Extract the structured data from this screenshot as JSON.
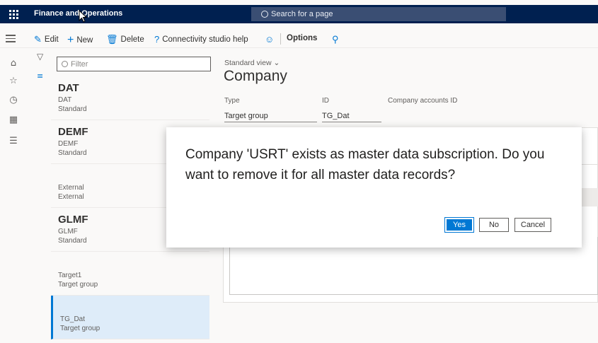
{
  "header": {
    "app_title": "Finance and Operations",
    "search_placeholder": "Search for a page"
  },
  "actions": {
    "edit": "Edit",
    "new": "New",
    "delete": "Delete",
    "connectivity_help": "Connectivity studio help",
    "options": "Options"
  },
  "list": {
    "filter_placeholder": "Filter",
    "items": [
      {
        "title": "DAT",
        "line1": "DAT",
        "line2": "Standard"
      },
      {
        "title": "DEMF",
        "line1": "DEMF",
        "line2": "Standard"
      },
      {
        "title": "",
        "line1": "External",
        "line2": "External"
      },
      {
        "title": "GLMF",
        "line1": "GLMF",
        "line2": "Standard"
      },
      {
        "title": "",
        "line1": "Target1",
        "line2": "Target group"
      },
      {
        "title": "",
        "line1": "TG_Dat",
        "line2": "Target group"
      }
    ]
  },
  "details": {
    "view_label": "Standard view",
    "page_title": "Company",
    "fields": [
      {
        "label": "Type",
        "value": "Target group"
      },
      {
        "label": "ID",
        "value": "TG_Dat"
      },
      {
        "label": "Company accounts ID",
        "value": ""
      }
    ]
  },
  "dialog": {
    "message": "Company 'USRT' exists as master data subscription. Do you want to remove it for all master data records?",
    "yes": "Yes",
    "no": "No",
    "cancel": "Cancel"
  },
  "colors": {
    "navbar": "#002050",
    "accent": "#0078d4",
    "selected_row": "#deecf9"
  }
}
